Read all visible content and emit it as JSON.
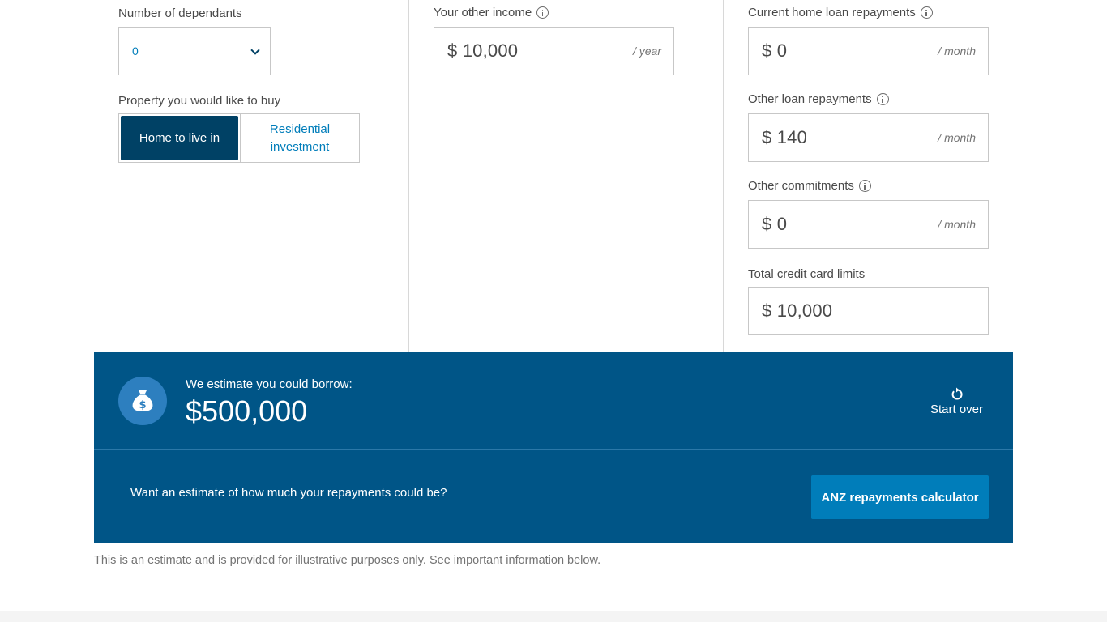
{
  "dependants": {
    "label": "Number of dependants",
    "selected": "0"
  },
  "property": {
    "label": "Property you would like to buy",
    "options": [
      "Home to live in",
      "Residential investment"
    ],
    "selected": "Home to live in"
  },
  "other_income": {
    "label": "Your other income",
    "value": "$ 10,000",
    "unit": "/ year"
  },
  "home_loan": {
    "label": "Current home loan repayments",
    "value": "$ 0",
    "unit": "/ month"
  },
  "other_loan": {
    "label": "Other loan repayments",
    "value": "$ 140",
    "unit": "/ month"
  },
  "commitments": {
    "label": "Other commitments",
    "value": "$ 0",
    "unit": "/ month"
  },
  "credit_limits": {
    "label": "Total credit card limits",
    "value": "$ 10,000"
  },
  "result": {
    "caption": "We estimate you could borrow:",
    "amount": "$500,000",
    "start_over": "Start over",
    "repay_question": "Want an estimate of how much your repayments could be?",
    "repay_button": "ANZ repayments calculator"
  },
  "disclaimer": "This is an estimate and is provided for illustrative purposes only. See important information below.",
  "colors": {
    "primary": "#004165",
    "panel": "#005587",
    "accent": "#007dba",
    "icon_circle": "#2d7fbf"
  },
  "icons": {
    "select": "chevron-down-icon",
    "info": "info-icon",
    "result": "money-bag-icon",
    "reset": "refresh-icon"
  }
}
